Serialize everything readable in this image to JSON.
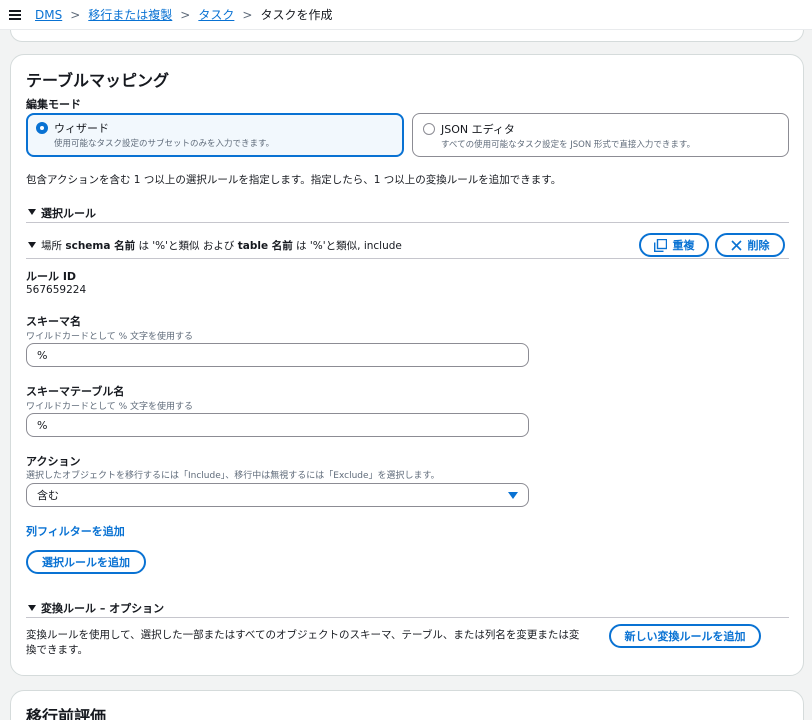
{
  "breadcrumb": {
    "items": [
      "DMS",
      "移行または複製",
      "タスク"
    ],
    "current": "タスクを作成"
  },
  "table_mapping": {
    "title": "テーブルマッピング",
    "edit_mode_label": "編集モード",
    "wizard": {
      "title": "ウィザード",
      "description": "使用可能なタスク設定のサブセットのみを入力できます。",
      "selected": true
    },
    "json_editor": {
      "title": "JSON エディタ",
      "description": "すべての使用可能なタスク設定を JSON 形式で直接入力できます。",
      "selected": false
    },
    "intro": "包含アクションを含む 1 つ以上の選択ルールを指定します。指定したら、1 つ以上の変換ルールを追加できます。"
  },
  "selection_rules": {
    "heading": "選択ルール",
    "rule": {
      "summary_prefix": "場所 ",
      "summary_schema": "schema 名前",
      "summary_mid1": " は '%'と類似 および ",
      "summary_table": "table 名前",
      "summary_mid2": " は '%'と類似, include",
      "duplicate_label": "重複",
      "delete_label": "削除",
      "rule_id_label": "ルール ID",
      "rule_id_value": "567659224",
      "schema_label": "スキーマ名",
      "schema_hint": "ワイルドカードとして % 文字を使用する",
      "schema_value": "%",
      "table_label": "スキーマテーブル名",
      "table_hint": "ワイルドカードとして % 文字を使用する",
      "table_value": "%",
      "action_label": "アクション",
      "action_hint": "選択したオブジェクトを移行するには「Include」、移行中は無視するには「Exclude」を選択します。",
      "action_value": "含む"
    },
    "add_column_filter": "列フィルターを追加",
    "add_selection_rule": "選択ルールを追加"
  },
  "transformation_rules": {
    "heading": "変換ルール – オプション",
    "description_line1": "変換ルールを使用して、選択した一部またはすべてのオブジェクトのスキーマ、テーブル、または列名を変更または変",
    "description_line2": "換できます。",
    "add_button": "新しい変換ルールを追加"
  },
  "premigration": {
    "title": "移行前評価"
  },
  "icons": {
    "menu": "hamburger-menu-icon",
    "duplicate": "copy-icon",
    "delete": "close-icon",
    "expand": "caret-down-icon",
    "select": "dropdown-caret-icon"
  },
  "colors": {
    "accent": "#0972d3",
    "text": "#16191f",
    "muted": "#5f6b7a",
    "background": "#f2f3f3"
  }
}
